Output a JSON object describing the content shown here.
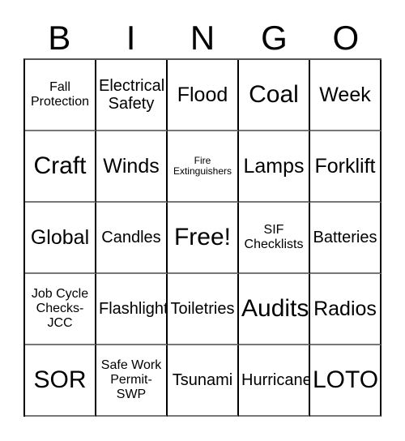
{
  "card": {
    "headers": [
      "B",
      "I",
      "N",
      "G",
      "O"
    ],
    "rows": [
      [
        {
          "text": "Fall Protection",
          "size": "sm"
        },
        {
          "text": "Electrical Safety",
          "size": "md"
        },
        {
          "text": "Flood",
          "size": "lg"
        },
        {
          "text": "Coal",
          "size": "xl"
        },
        {
          "text": "Week",
          "size": "lg"
        }
      ],
      [
        {
          "text": "Craft",
          "size": "xl"
        },
        {
          "text": "Winds",
          "size": "lg"
        },
        {
          "text": "Fire Extinguishers",
          "size": "xs"
        },
        {
          "text": "Lamps",
          "size": "lg"
        },
        {
          "text": "Forklift",
          "size": "lg"
        }
      ],
      [
        {
          "text": "Global",
          "size": "lg"
        },
        {
          "text": "Candles",
          "size": "md"
        },
        {
          "text": "Free!",
          "size": "xl"
        },
        {
          "text": "SIF Checklists",
          "size": "sm"
        },
        {
          "text": "Batteries",
          "size": "md"
        }
      ],
      [
        {
          "text": "Job Cycle Checks-JCC",
          "size": "sm"
        },
        {
          "text": "Flashlights",
          "size": "md"
        },
        {
          "text": "Toiletries",
          "size": "md"
        },
        {
          "text": "Audits",
          "size": "xl"
        },
        {
          "text": "Radios",
          "size": "lg"
        }
      ],
      [
        {
          "text": "SOR",
          "size": "xl"
        },
        {
          "text": "Safe Work Permit-SWP",
          "size": "sm"
        },
        {
          "text": "Tsunami",
          "size": "md"
        },
        {
          "text": "Hurricane",
          "size": "md"
        },
        {
          "text": "LOTO",
          "size": "xl"
        }
      ]
    ],
    "colors": {
      "border": "#000000",
      "text": "#000000",
      "background": "#ffffff"
    }
  }
}
